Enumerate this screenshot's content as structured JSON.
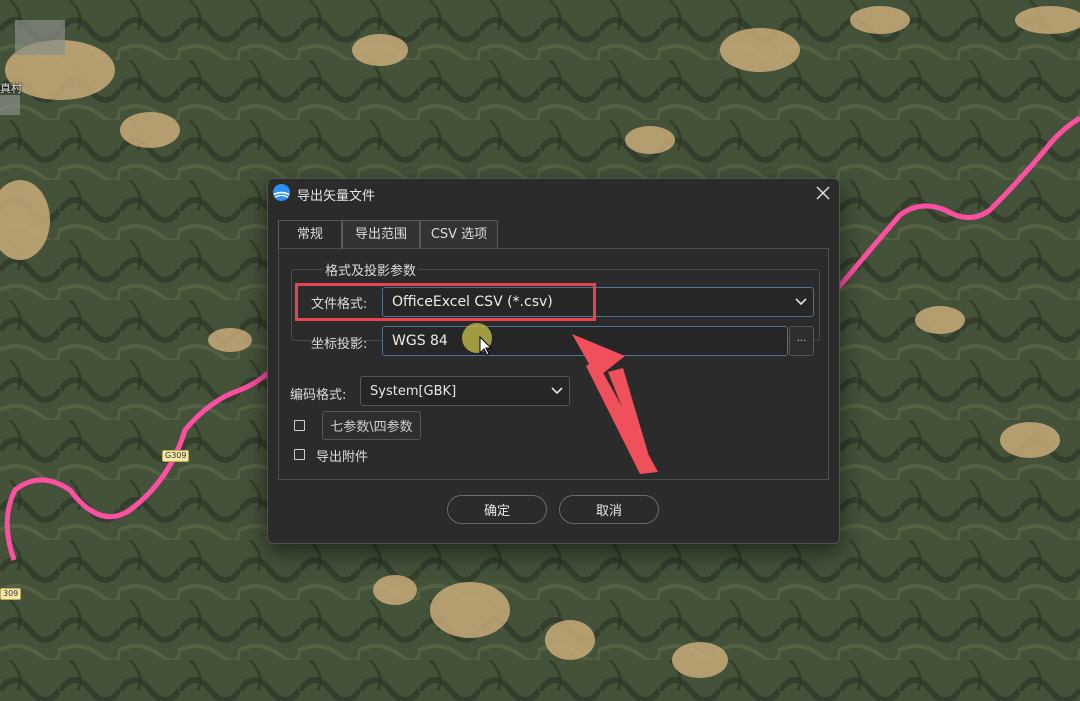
{
  "map": {
    "labels": [
      "真村"
    ],
    "badges": [
      "G309",
      "309"
    ],
    "road_color": "#ff4fa3"
  },
  "dialog": {
    "title": "导出矢量文件",
    "app_icon": "app-logo-icon",
    "close_icon": "close-icon",
    "tabs": [
      {
        "label": "常规",
        "active": true
      },
      {
        "label": "导出范围",
        "active": false
      },
      {
        "label": "CSV 选项",
        "active": false
      }
    ],
    "group": {
      "legend": "格式及投影参数",
      "file_format_label": "文件格式:",
      "file_format_value": "OfficeExcel CSV (*.csv)",
      "projection_label": "坐标投影:",
      "projection_value": "WGS 84",
      "projection_browse_label": "···"
    },
    "encoding_label": "编码格式:",
    "encoding_value": "System[GBK]",
    "seven_params_label": "七参数\\四参数",
    "seven_params_checked": false,
    "export_attachment_label": "导出附件",
    "export_attachment_checked": false,
    "ok_label": "确定",
    "cancel_label": "取消"
  },
  "annotation": {
    "highlight_color": "#e8434f",
    "arrow_color": "#f0505c"
  }
}
